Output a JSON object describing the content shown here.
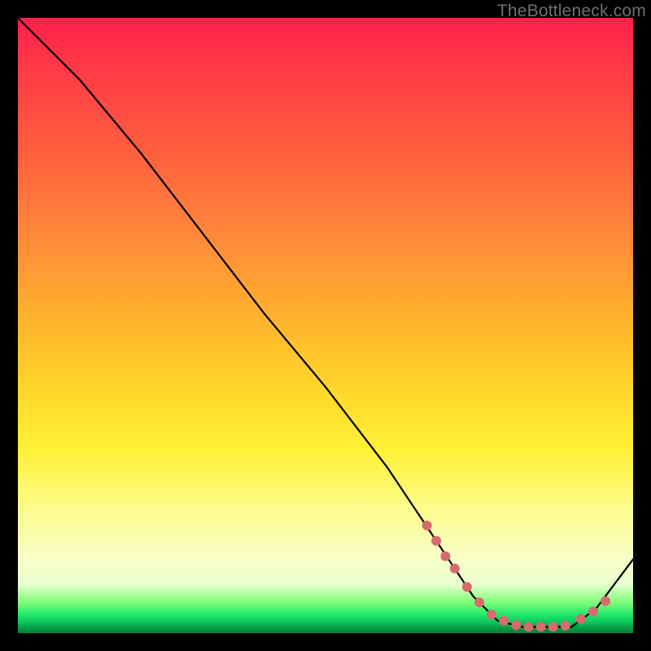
{
  "watermark": "TheBottleneck.com",
  "chart_data": {
    "type": "line",
    "title": "",
    "xlabel": "",
    "ylabel": "",
    "xlim": [
      0,
      100
    ],
    "ylim": [
      0,
      100
    ],
    "grid": false,
    "legend": false,
    "series": [
      {
        "name": "curve",
        "color": "#000000",
        "x": [
          0,
          6,
          10,
          20,
          30,
          40,
          50,
          60,
          66,
          70,
          74,
          78,
          82,
          86,
          90,
          94,
          100
        ],
        "y": [
          100,
          94,
          90,
          78,
          65,
          52,
          40,
          27,
          18,
          12,
          6,
          2,
          1,
          1,
          1,
          4,
          12
        ]
      }
    ],
    "markers": {
      "name": "highlight-dots",
      "color": "#d96a6f",
      "radius": 6,
      "points_x": [
        66.5,
        68,
        69.5,
        71,
        73,
        75,
        77,
        79,
        81,
        83,
        85,
        87,
        89,
        91.5,
        93.5,
        95.5
      ],
      "points_y": [
        17.5,
        15,
        12.5,
        10.5,
        7.5,
        5,
        3,
        2,
        1.3,
        1,
        1,
        1,
        1.2,
        2.3,
        3.5,
        5.2
      ]
    }
  }
}
